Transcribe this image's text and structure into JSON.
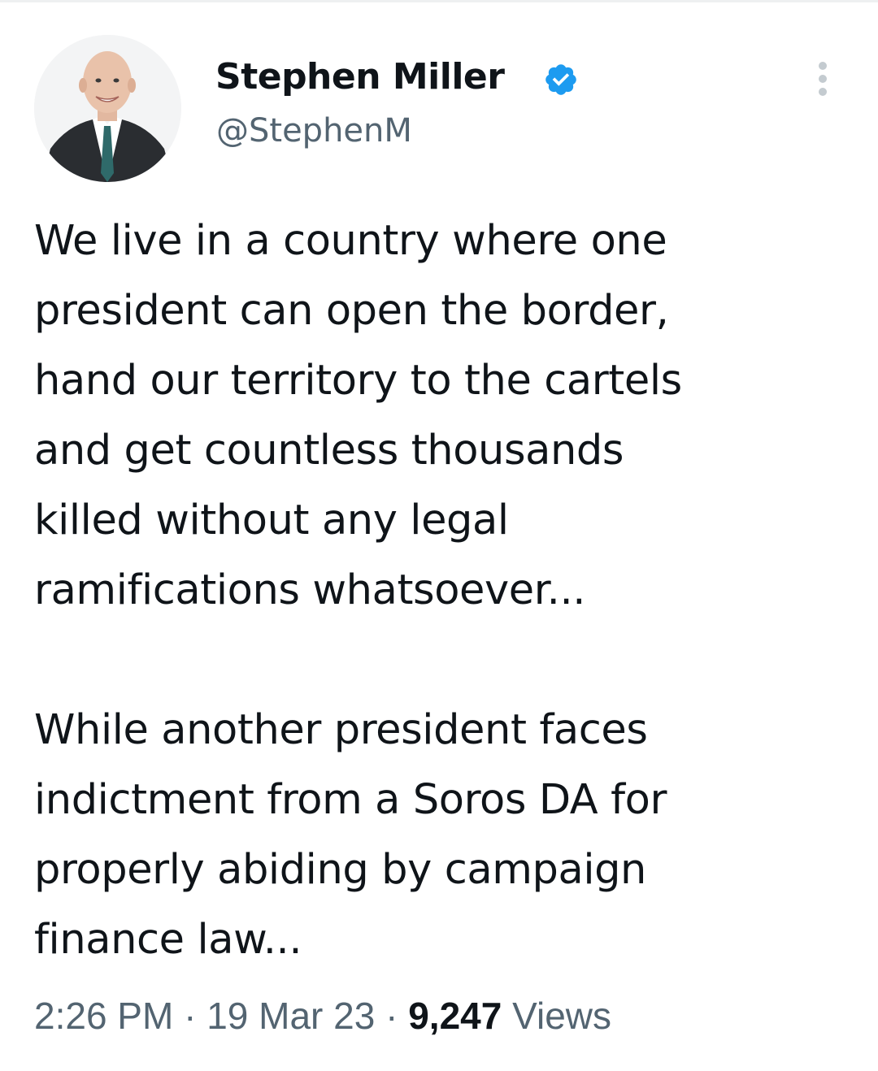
{
  "author": {
    "display_name": "Stephen Miller",
    "handle": "@StephenM",
    "verified": true,
    "avatar_icon": "profile-photo"
  },
  "menu_icon": "more-vertical-icon",
  "tweet": {
    "paragraph1": [
      "We live in a country where one",
      "president can open the border,",
      "hand our territory to the cartels",
      "and get countless thousands",
      "killed without any legal",
      "ramifications whatsoever..."
    ],
    "paragraph2": [
      "While another president faces",
      "indictment from a Soros DA for",
      "properly abiding by campaign",
      "finance law..."
    ]
  },
  "meta": {
    "time": "2:26 PM",
    "separator": "·",
    "date": "19 Mar 23",
    "views_count": "9,247",
    "views_label": "Views"
  },
  "colors": {
    "verified_blue": "#1d9bf0",
    "text_primary": "#0f1419",
    "text_secondary": "#536471"
  }
}
